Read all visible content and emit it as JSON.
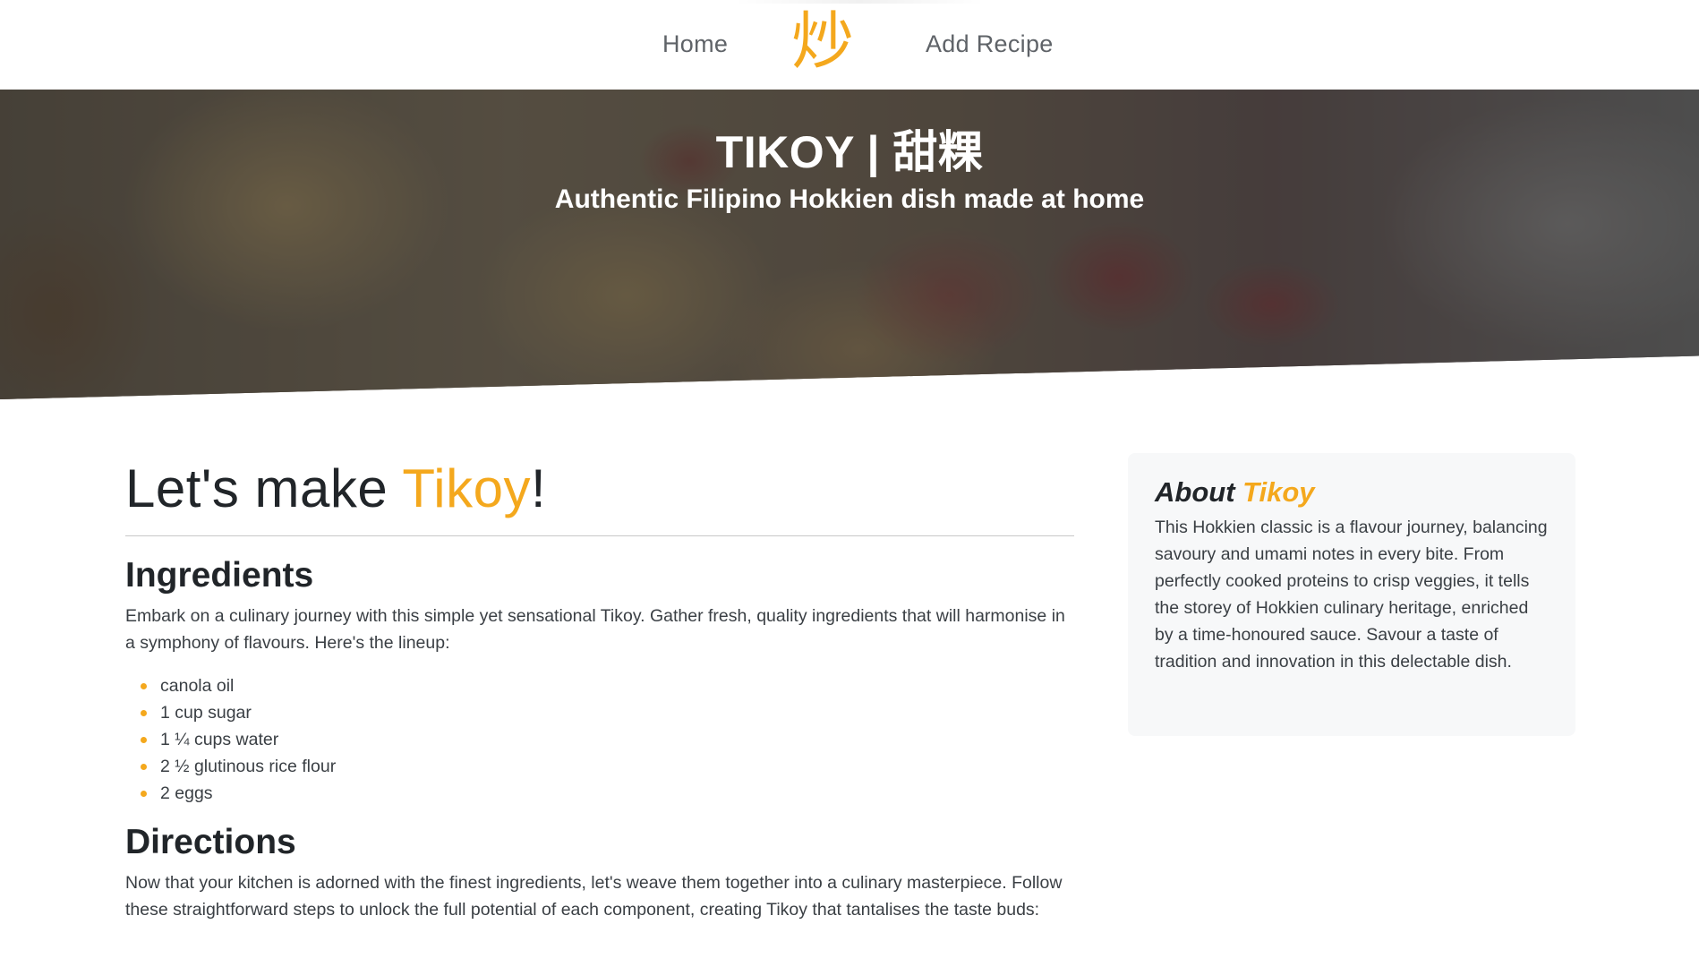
{
  "nav": {
    "home_label": "Home",
    "logo_glyph": "炒",
    "add_recipe_label": "Add Recipe"
  },
  "hero": {
    "title": "TIKOY | 甜粿",
    "subtitle": "Authentic Filipino Hokkien dish made at home"
  },
  "main": {
    "heading_prefix": "Let's make ",
    "heading_dish": "Tikoy",
    "heading_suffix": "!",
    "ingredients_title": "Ingredients",
    "ingredients_intro": "Embark on a culinary journey with this simple yet sensational Tikoy. Gather fresh, quality ingredients that will harmonise in a symphony of flavours. Here's the lineup:",
    "ingredients": [
      "canola oil",
      "1 cup sugar",
      "1 ¼ cups water",
      "2 ½ glutinous rice flour",
      "2 eggs"
    ],
    "directions_title": "Directions",
    "directions_intro": "Now that your kitchen is adorned with the finest ingredients, let's weave them together into a culinary masterpiece. Follow these straightforward steps to unlock the full potential of each component, creating Tikoy that tantalises the taste buds:"
  },
  "about": {
    "title_prefix": "About ",
    "title_dish": "Tikoy",
    "text": "This Hokkien classic is a flavour journey, balancing savoury and umami notes in every bite. From perfectly cooked proteins to crisp veggies, it tells the storey of Hokkien culinary heritage, enriched by a time-honoured sauce. Savour a taste of tradition and innovation in this delectable dish."
  },
  "colors": {
    "accent": "#f4a81d",
    "text": "#212529",
    "card_bg": "#f7f8f9"
  }
}
